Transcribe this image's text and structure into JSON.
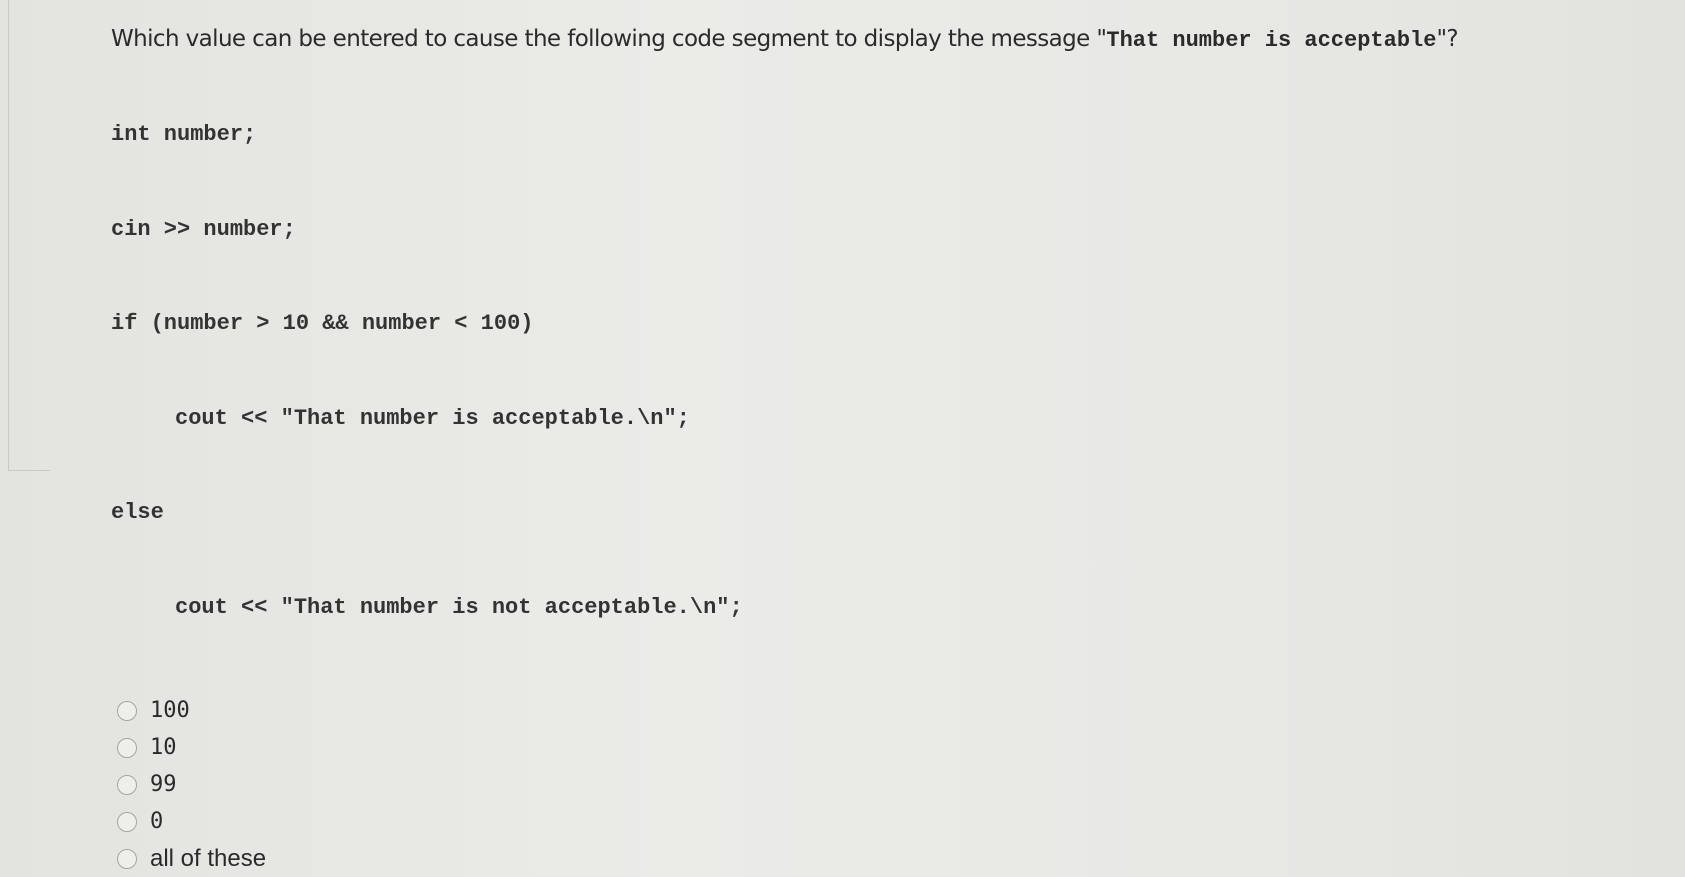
{
  "question": {
    "prefix": "Which value can be entered to cause the following code segment to display the message \"",
    "message": "That number is acceptable",
    "suffix": "\"?"
  },
  "code": {
    "lines": [
      "int number;",
      "cin >> number;",
      "if (number > 10 && number < 100)",
      "cout << \"That number is acceptable.\\n\";",
      "else",
      "cout << \"That number is not acceptable.\\n\";"
    ]
  },
  "options": [
    {
      "label": "100",
      "selected": false
    },
    {
      "label": "10",
      "selected": false
    },
    {
      "label": "99",
      "selected": false
    },
    {
      "label": "0",
      "selected": false
    },
    {
      "label": "all of these",
      "selected": false
    }
  ]
}
